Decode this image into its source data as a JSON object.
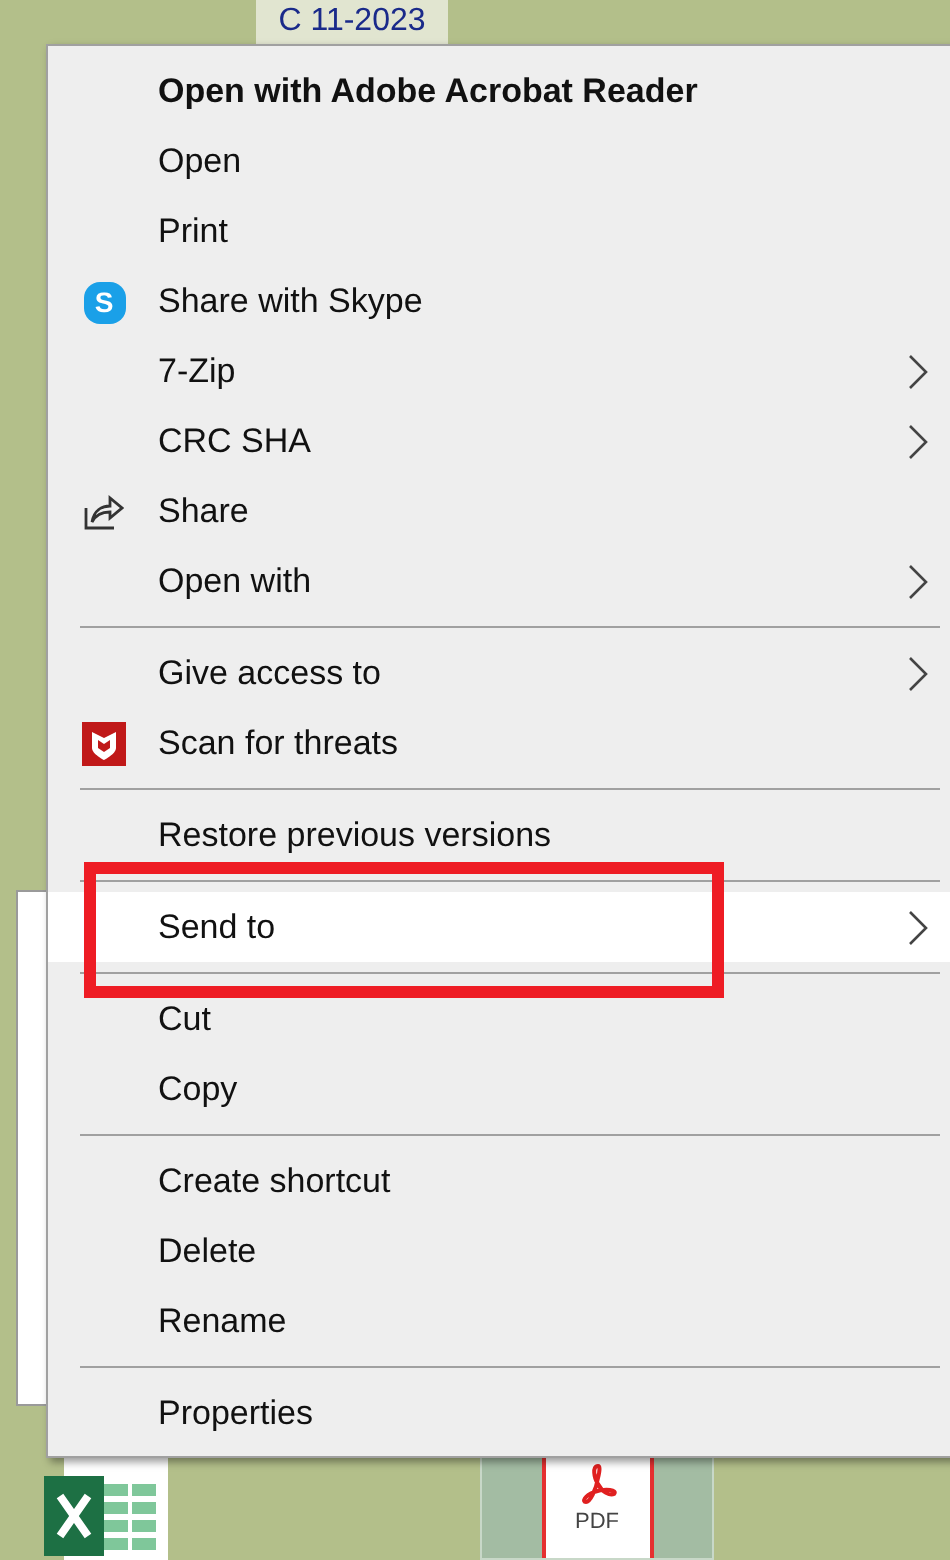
{
  "desktop": {
    "top_label": "C 11-2023",
    "pdf_label": "PDF"
  },
  "menu": [
    {
      "kind": "item",
      "label": "Open with Adobe Acrobat Reader",
      "bold": true,
      "submenu": false,
      "selected": false
    },
    {
      "kind": "item",
      "label": "Open",
      "bold": false,
      "submenu": false,
      "selected": false
    },
    {
      "kind": "item",
      "label": "Print",
      "bold": false,
      "submenu": false,
      "selected": false
    },
    {
      "kind": "skype",
      "label": "Share with Skype",
      "bold": false,
      "icon_text": "S",
      "submenu": false,
      "selected": false
    },
    {
      "kind": "item",
      "label": "7-Zip",
      "bold": false,
      "submenu": true,
      "selected": false
    },
    {
      "kind": "item",
      "label": "CRC SHA",
      "bold": false,
      "submenu": true,
      "selected": false
    },
    {
      "kind": "share",
      "label": "Share",
      "bold": false,
      "submenu": false,
      "selected": false
    },
    {
      "kind": "item",
      "label": "Open with",
      "bold": false,
      "submenu": true,
      "selected": false
    },
    {
      "kind": "separator"
    },
    {
      "kind": "item",
      "label": "Give access to",
      "bold": false,
      "submenu": true,
      "selected": false
    },
    {
      "kind": "shield",
      "label": "Scan for threats",
      "bold": false,
      "submenu": false,
      "selected": false
    },
    {
      "kind": "separator"
    },
    {
      "kind": "item",
      "label": "Restore previous versions",
      "bold": false,
      "submenu": false,
      "selected": false
    },
    {
      "kind": "separator"
    },
    {
      "kind": "item",
      "label": "Send to",
      "bold": false,
      "submenu": true,
      "selected": true
    },
    {
      "kind": "separator"
    },
    {
      "kind": "item",
      "label": "Cut",
      "bold": false,
      "submenu": false,
      "selected": false
    },
    {
      "kind": "item",
      "label": "Copy",
      "bold": false,
      "submenu": false,
      "selected": false
    },
    {
      "kind": "separator"
    },
    {
      "kind": "item",
      "label": "Create shortcut",
      "bold": false,
      "submenu": false,
      "selected": false
    },
    {
      "kind": "item",
      "label": "Delete",
      "bold": false,
      "submenu": false,
      "selected": false
    },
    {
      "kind": "item",
      "label": "Rename",
      "bold": false,
      "submenu": false,
      "selected": false
    },
    {
      "kind": "separator"
    },
    {
      "kind": "item",
      "label": "Properties",
      "bold": false,
      "submenu": false,
      "selected": false
    }
  ]
}
